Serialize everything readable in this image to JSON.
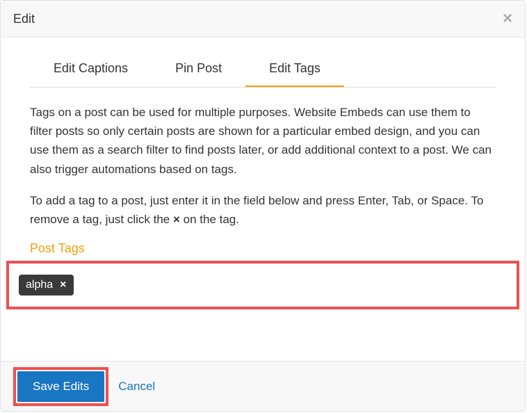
{
  "modal": {
    "title": "Edit"
  },
  "tabs": {
    "captions": "Edit Captions",
    "pin": "Pin Post",
    "tags": "Edit Tags"
  },
  "content": {
    "para1": "Tags on a post can be used for multiple purposes. Website Embeds can use them to filter posts so only certain posts are shown for a particular embed design, and you can use them as a search filter to find posts later, or add additional context to a post. We can also trigger automations based on tags.",
    "para2_before": "To add a tag to a post, just enter it in the field below and press Enter, Tab, or Space. To remove a tag, just click the ",
    "para2_x": "×",
    "para2_after": " on the tag.",
    "section_label": "Post Tags"
  },
  "tags": [
    {
      "label": "alpha"
    }
  ],
  "footer": {
    "save": "Save Edits",
    "cancel": "Cancel"
  }
}
